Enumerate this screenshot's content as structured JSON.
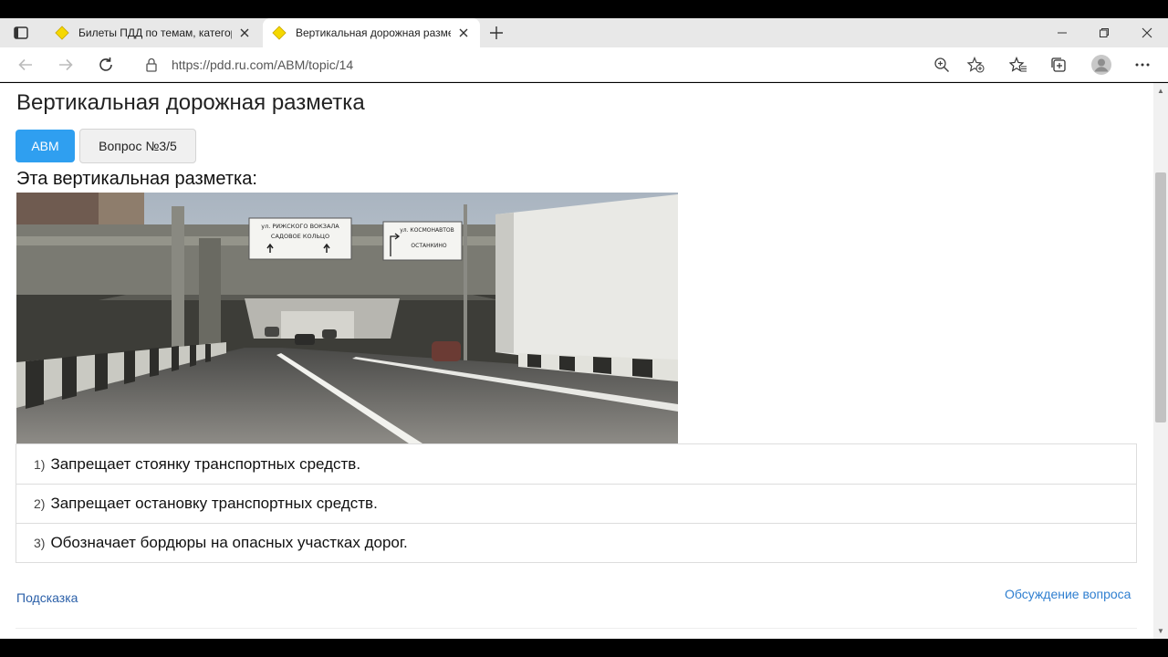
{
  "browser": {
    "tabs": [
      {
        "label": "Билеты ПДД по темам, категор",
        "active": false
      },
      {
        "label": "Вертикальная дорожная разме",
        "active": true
      }
    ],
    "url": "https://pdd.ru.com/ABM/topic/14",
    "icons": {
      "tab_actions": "tab-actions-icon",
      "favicon": "yellow-diamond-icon",
      "close": "close-icon",
      "new_tab": "plus-icon",
      "minimize": "minimize-icon",
      "restore": "restore-icon",
      "window_close": "close-icon",
      "back": "back-arrow-icon",
      "forward": "forward-arrow-icon",
      "refresh": "refresh-icon",
      "lock": "lock-icon",
      "zoom": "zoom-icon",
      "add_favorite": "star-plus-icon",
      "favorites": "favorites-icon",
      "collections": "collections-icon",
      "profile": "profile-icon",
      "menu": "more-icon"
    }
  },
  "page": {
    "title": "Вертикальная дорожная разметка",
    "category_button": "ABM",
    "question_counter": "Вопрос №3/5",
    "question_text": "Эта вертикальная разметка:",
    "image": {
      "sign_left_line1": "ул. РИЖСКОГО ВОКЗАЛА",
      "sign_left_line2": "САДОВОЕ КОЛЬЦО",
      "sign_right_line1": "ул. КОСМОНАВТОВ",
      "sign_right_line2": "ОСТАНКИНО"
    },
    "answers": [
      {
        "num": "1)",
        "text": "Запрещает стоянку транспортных средств."
      },
      {
        "num": "2)",
        "text": "Запрещает остановку транспортных средств."
      },
      {
        "num": "3)",
        "text": "Обозначает бордюры на опасных участках дорог."
      }
    ],
    "hint_link": "Подсказка",
    "discussion_link": "Обсуждение вопроса"
  },
  "colors": {
    "accent": "#2f9ff0",
    "link": "#2a5fa8",
    "favicon": "#f5d800"
  }
}
